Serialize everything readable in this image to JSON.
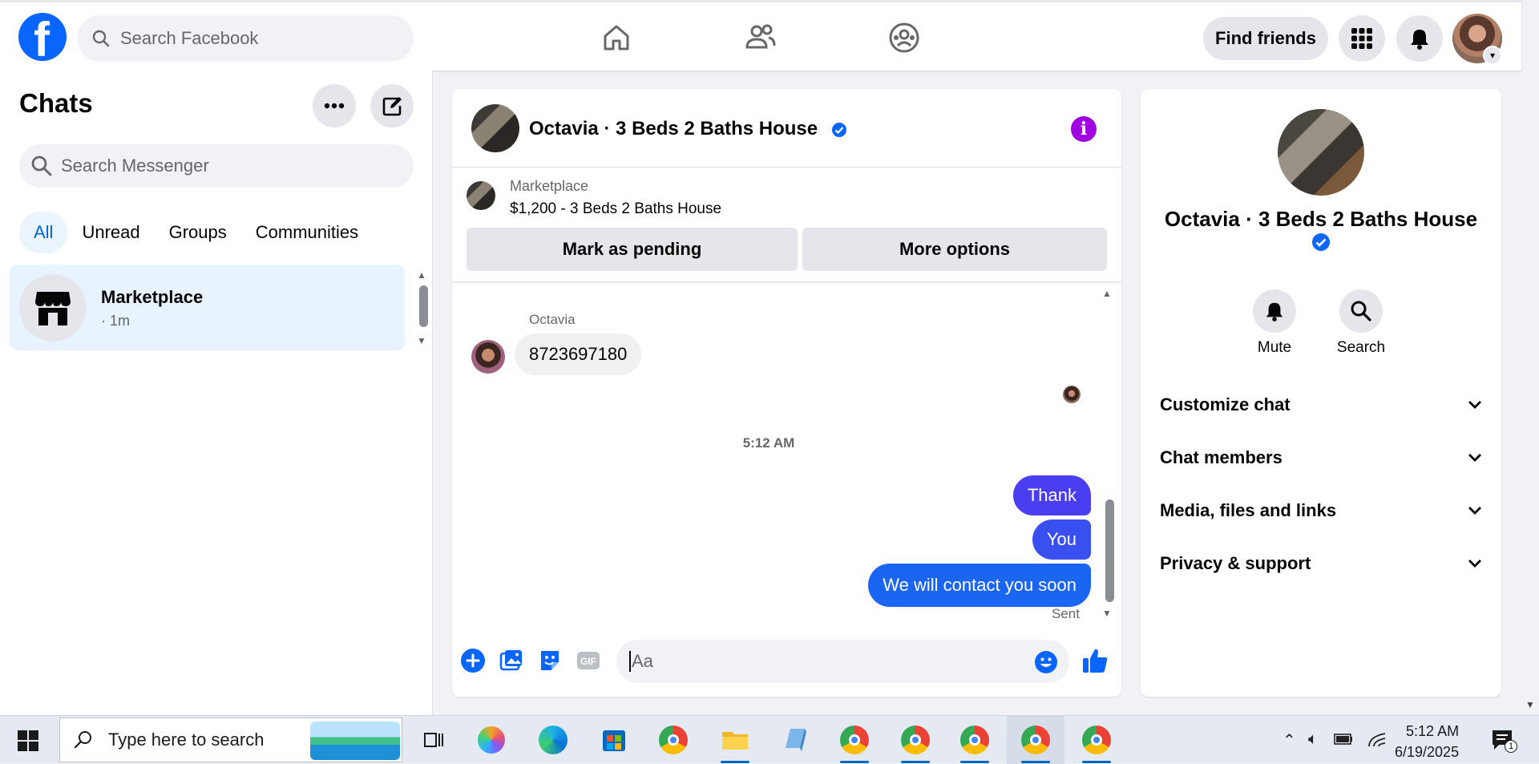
{
  "topbar": {
    "search_placeholder": "Search Facebook",
    "find_friends": "Find friends"
  },
  "chats": {
    "title": "Chats",
    "search_placeholder": "Search Messenger",
    "filters": [
      "All",
      "Unread",
      "Groups",
      "Communities"
    ],
    "active_filter": "All",
    "items": [
      {
        "name": "Marketplace",
        "time": "· 1m"
      }
    ]
  },
  "conversation": {
    "title": "Octavia · 3 Beds 2 Baths House",
    "marketplace_label": "Marketplace",
    "listing": "$1,200 - 3 Beds 2 Baths House",
    "mark_pending": "Mark as pending",
    "more_options": "More options",
    "sender_name": "Octavia",
    "incoming": "8723697180",
    "timestamp": "5:12 AM",
    "outgoing": [
      "Thank",
      "You",
      "We will contact you soon"
    ],
    "status": "Sent",
    "composer_placeholder": "Aa"
  },
  "details": {
    "name": "Octavia · 3 Beds 2 Baths House",
    "mute": "Mute",
    "search": "Search",
    "sections": [
      "Customize chat",
      "Chat members",
      "Media, files and links",
      "Privacy & support"
    ]
  },
  "taskbar": {
    "search_placeholder": "Type here to search",
    "time": "5:12 AM",
    "date": "6/19/2025",
    "notification_count": "1"
  },
  "colors": {
    "facebook_blue": "#0866ff",
    "bubble_out_top": "#4b3df0",
    "bubble_out_bottom": "#1a66f2",
    "info_purple": "#a000e0",
    "active_filter": "#0064d1"
  }
}
